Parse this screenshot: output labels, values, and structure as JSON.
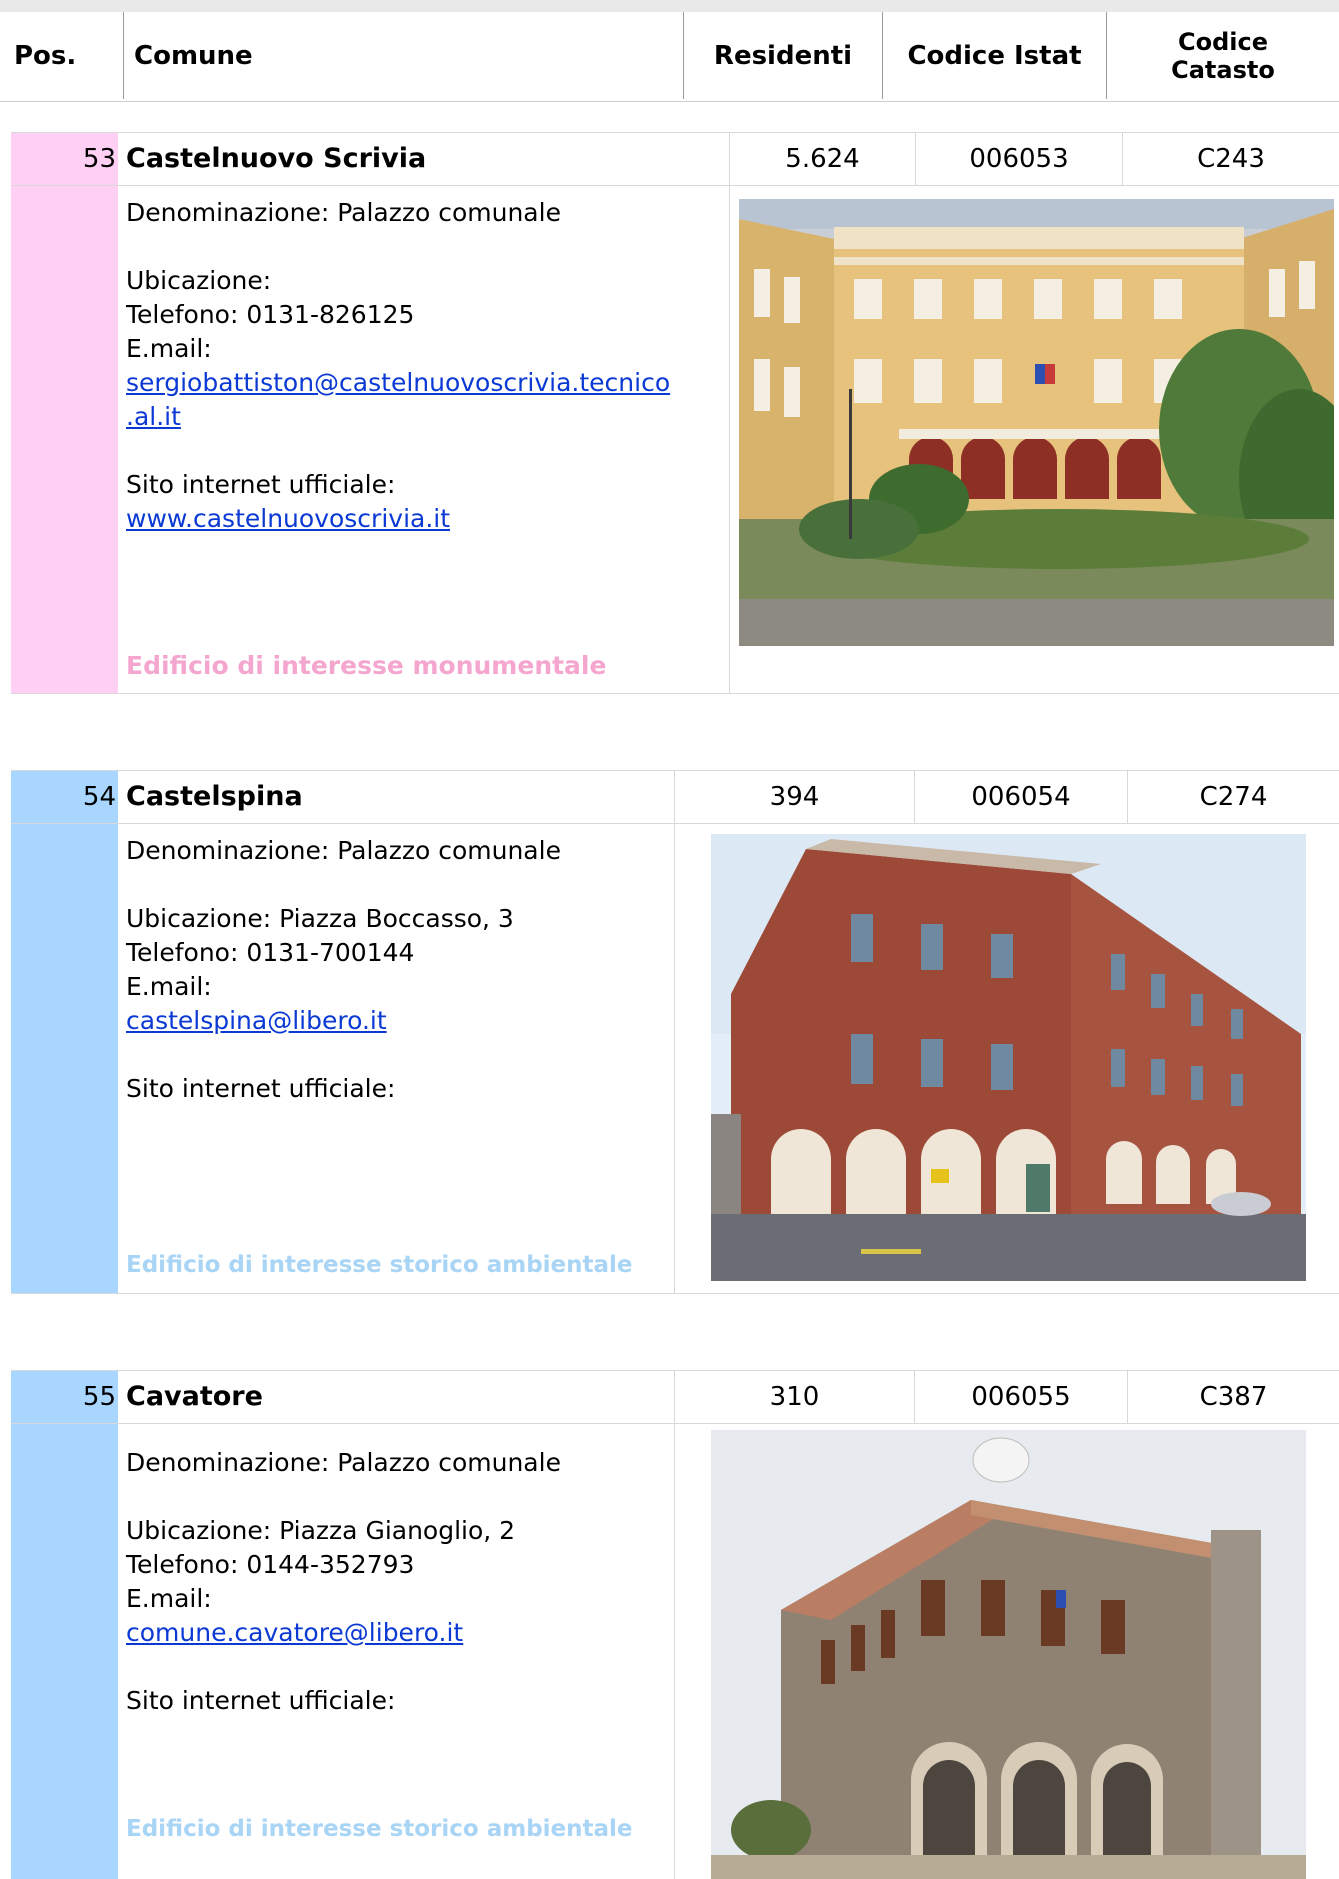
{
  "header": {
    "pos": "Pos.",
    "comune": "Comune",
    "residenti": "Residenti",
    "codice_istat": "Codice Istat",
    "codice_catasto_l1": "Codice",
    "codice_catasto_l2": "Catasto"
  },
  "colors": {
    "pink": "#ffd0f4",
    "pink_text": "#f5a6cf",
    "blue": "#a8d6ff",
    "blue_text": "#a8d4f5",
    "link": "#0b39d4"
  },
  "records": [
    {
      "pos": "53",
      "comune": "Castelnuovo Scrivia",
      "residenti": "5.624",
      "istat": "006053",
      "catasto": "C243",
      "denominazione": "Denominazione: Palazzo comunale",
      "ubicazione": "Ubicazione:",
      "telefono": "Telefono: 0131-826125",
      "email_label": "E.mail:",
      "email_l1": "sergiobattiston@castelnuovoscrivia.tecnico",
      "email_l2": ".al.it",
      "sito_label": "Sito internet ufficiale:",
      "sito": "www.castelnuovoscrivia.it",
      "tag": "Edificio di interesse monumentale"
    },
    {
      "pos": "54",
      "comune": "Castelspina",
      "residenti": "394",
      "istat": "006054",
      "catasto": "C274",
      "denominazione": "Denominazione: Palazzo comunale",
      "ubicazione": "Ubicazione: Piazza Boccasso, 3",
      "telefono": "Telefono: 0131-700144",
      "email_label": "E.mail:",
      "email": "castelspina@libero.it",
      "sito_label": "Sito internet ufficiale:",
      "tag": "Edificio di interesse storico ambientale"
    },
    {
      "pos": "55",
      "comune": "Cavatore",
      "residenti": "310",
      "istat": "006055",
      "catasto": "C387",
      "denominazione": "Denominazione: Palazzo comunale",
      "ubicazione": "Ubicazione: Piazza Gianoglio, 2",
      "telefono": "Telefono: 0144-352793",
      "email_label": "E.mail:",
      "email": "comune.cavatore@libero.it",
      "sito_label": "Sito internet ufficiale:",
      "tag": "Edificio di interesse storico ambientale"
    }
  ]
}
